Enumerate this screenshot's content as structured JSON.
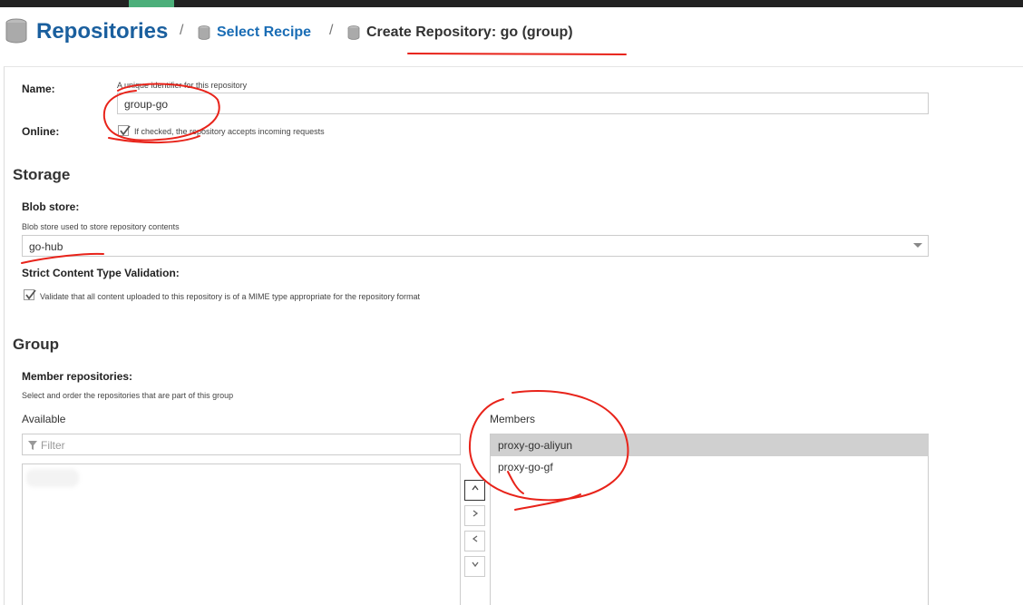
{
  "breadcrumb": {
    "root": "Repositories",
    "separator": "/",
    "step1": "Select Recipe",
    "current": "Create Repository: go (group)"
  },
  "name": {
    "label": "Name:",
    "help": "A unique identifier for this repository",
    "value": "group-go"
  },
  "online": {
    "label": "Online:",
    "help": "If checked, the repository accepts incoming requests",
    "checked": true
  },
  "storage": {
    "section_title": "Storage",
    "blob_store_label": "Blob store:",
    "blob_store_help": "Blob store used to store repository contents",
    "blob_store_value": "go-hub",
    "strict_label": "Strict Content Type Validation:",
    "strict_help": "Validate that all content uploaded to this repository is of a MIME type appropriate for the repository format",
    "strict_checked": true
  },
  "group": {
    "section_title": "Group",
    "members_label": "Member repositories:",
    "members_help": "Select and order the repositories that are part of this group",
    "available_title": "Available",
    "filter_placeholder": "Filter",
    "members_title": "Members",
    "members": [
      "proxy-go-aliyun",
      "proxy-go-gf"
    ],
    "selected_member": "proxy-go-aliyun"
  },
  "colors": {
    "brand_blue": "#1a5f9e",
    "link_blue": "#1a6db5",
    "annotation_red": "#e8231a",
    "selected_row": "#d0d0d0"
  }
}
